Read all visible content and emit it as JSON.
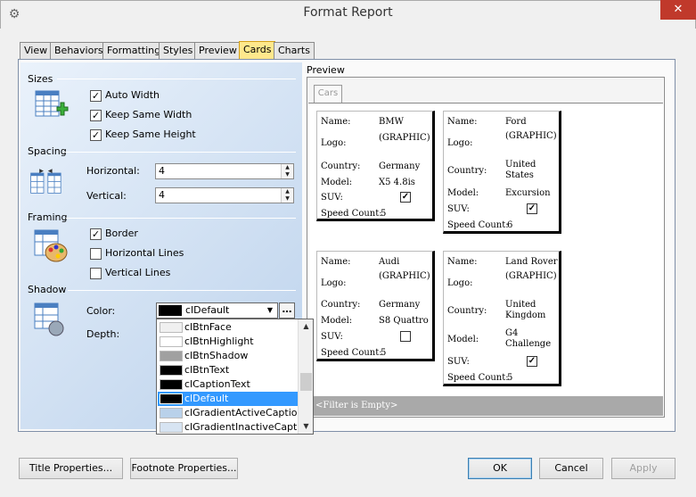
{
  "window": {
    "title": "Format Report",
    "close_glyph": "✕",
    "icon": "gear-icon"
  },
  "tabs": [
    "View",
    "Behaviors",
    "Formatting",
    "Styles",
    "Preview",
    "Cards",
    "Charts"
  ],
  "active_tab": "Cards",
  "sizes": {
    "label": "Sizes",
    "options": [
      {
        "label": "Auto Width",
        "checked": true
      },
      {
        "label": "Keep Same Width",
        "checked": true
      },
      {
        "label": "Keep Same Height",
        "checked": true
      }
    ]
  },
  "spacing": {
    "label": "Spacing",
    "horizontal_label": "Horizontal:",
    "horizontal_value": "4",
    "vertical_label": "Vertical:",
    "vertical_value": "4"
  },
  "framing": {
    "label": "Framing",
    "options": [
      {
        "label": "Border",
        "checked": true
      },
      {
        "label": "Horizontal Lines",
        "checked": false
      },
      {
        "label": "Vertical Lines",
        "checked": false
      }
    ]
  },
  "shadow": {
    "label": "Shadow",
    "color_label": "Color:",
    "depth_label": "Depth:",
    "color_value": "clDefault",
    "ellipsis": "…"
  },
  "color_dropdown": [
    {
      "label": "clBtnFace",
      "color": "#f0f0f0"
    },
    {
      "label": "clBtnHighlight",
      "color": "#ffffff"
    },
    {
      "label": "clBtnShadow",
      "color": "#a0a0a0"
    },
    {
      "label": "clBtnText",
      "color": "#000000"
    },
    {
      "label": "clCaptionText",
      "color": "#000000"
    },
    {
      "label": "clDefault",
      "color": "#000000",
      "selected": true
    },
    {
      "label": "clGradientActiveCaption",
      "color": "#b9d1ea"
    },
    {
      "label": "clGradientInactiveCaption",
      "color": "#d7e4f2"
    }
  ],
  "preview": {
    "label": "Preview",
    "tab": "Cars",
    "filter_text": "<Filter is Empty>",
    "field_labels": [
      "Name:",
      "Logo:",
      "Country:",
      "Model:",
      "SUV:",
      "Speed Count:"
    ],
    "cards": [
      {
        "name": "BMW",
        "logo": "(GRAPHIC)",
        "country": "Germany",
        "model": "X5 4.8is",
        "suv": true,
        "speed": "5"
      },
      {
        "name": "Ford",
        "logo": "(GRAPHIC)",
        "country": "United States",
        "model": "Excursion",
        "suv": true,
        "speed": "6"
      },
      {
        "name": "Audi",
        "logo": "(GRAPHIC)",
        "country": "Germany",
        "model": "S8 Quattro",
        "suv": false,
        "speed": "5"
      },
      {
        "name": "Land Rover",
        "logo": "(GRAPHIC)",
        "country": "United Kingdom",
        "model": "G4 Challenge",
        "suv": true,
        "speed": "5"
      }
    ]
  },
  "buttons": {
    "title_properties": "Title Properties...",
    "footnote_properties": "Footnote Properties...",
    "ok": "OK",
    "cancel": "Cancel",
    "apply": "Apply"
  },
  "colors": {
    "accent_tab": "#ffe88c",
    "selection": "#3399ff",
    "close": "#c0392b"
  }
}
